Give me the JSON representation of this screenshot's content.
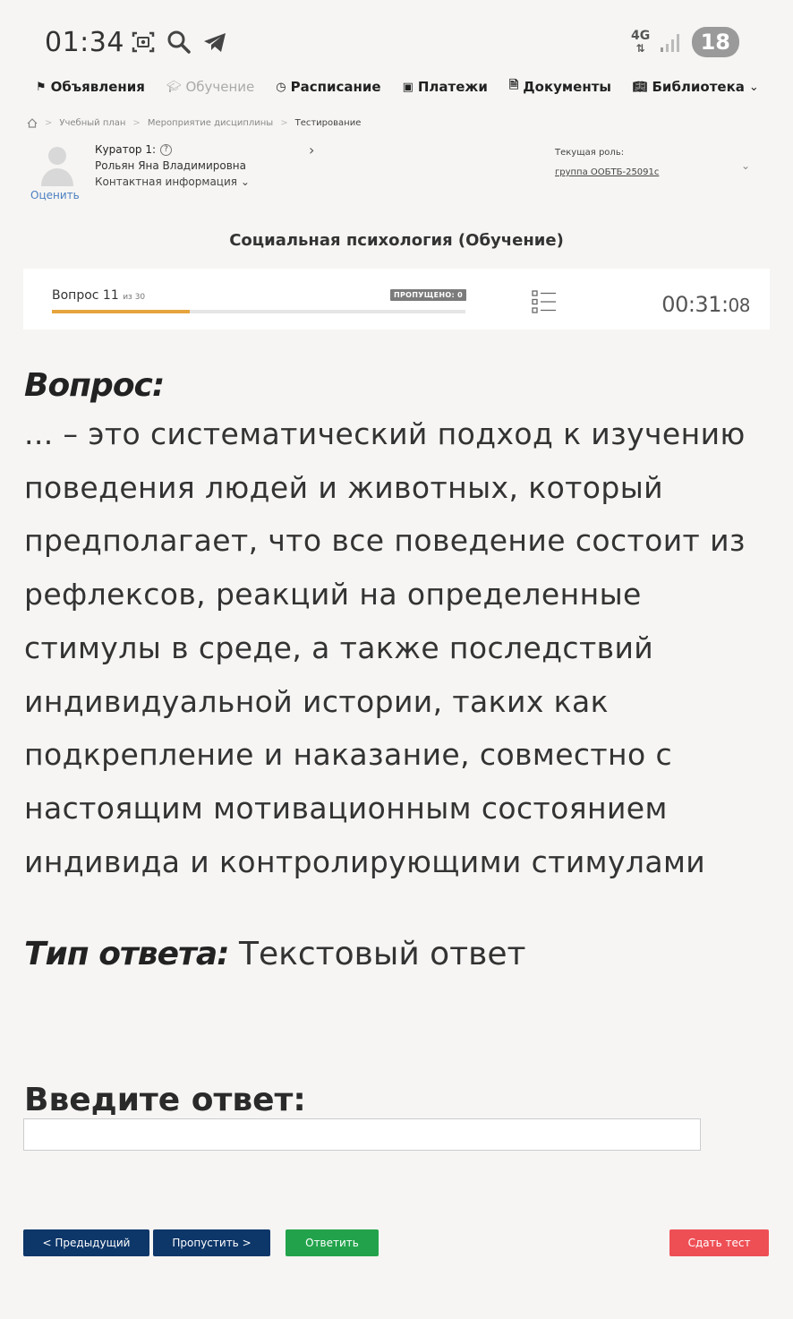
{
  "status_bar": {
    "time": "01:34",
    "network": "4G",
    "battery": "18"
  },
  "nav": {
    "items": [
      {
        "label": "Объявления",
        "icon": "megaphone-icon"
      },
      {
        "label": "Обучение",
        "icon": "graduation-cap-icon"
      },
      {
        "label": "Расписание",
        "icon": "clock-icon"
      },
      {
        "label": "Платежи",
        "icon": "wallet-icon"
      },
      {
        "label": "Документы",
        "icon": "document-icon"
      },
      {
        "label": "Библиотека",
        "icon": "book-icon"
      }
    ]
  },
  "breadcrumb": {
    "items": [
      "Учебный план",
      "Мероприятие дисциплины",
      "Тестирование"
    ]
  },
  "curator": {
    "title": "Куратор 1:",
    "name": "Рольян Яна Владимировна",
    "contact": "Контактная информация",
    "rate": "Оценить"
  },
  "role": {
    "label": "Текущая роль:",
    "group": "группа ООБТБ-25091с"
  },
  "course_title": "Социальная психология (Обучение)",
  "progress": {
    "question_label": "Вопрос 11",
    "of_total": "из 30",
    "skipped": "ПРОПУЩЕНО: 0",
    "fraction": 0.3333,
    "timer_main": "00:31:",
    "timer_sec": "08"
  },
  "question": {
    "label": "Вопрос:",
    "text": "... – это систематический подход к изучению поведения людей и животных, который предполагает, что все поведение состоит из рефлексов, реакций на определенные стимулы в среде, а также последствий индивидуальной истории, таких как подкрепление и наказание, совместно с настоящим мотивационным состоянием индивида и контролирующими стимулами"
  },
  "answer_type": {
    "label": "Тип ответа:",
    "value": "Текстовый ответ"
  },
  "answer": {
    "label": "Введите ответ:",
    "value": ""
  },
  "buttons": {
    "prev": "< Предыдущий",
    "skip": "Пропустить >",
    "answer": "Ответить",
    "submit": "Сдать тест"
  },
  "colors": {
    "progress_fill": "#e6a43d",
    "primary_button": "#0d3669",
    "answer_button": "#22a34b",
    "submit_button": "#ee4f55"
  }
}
